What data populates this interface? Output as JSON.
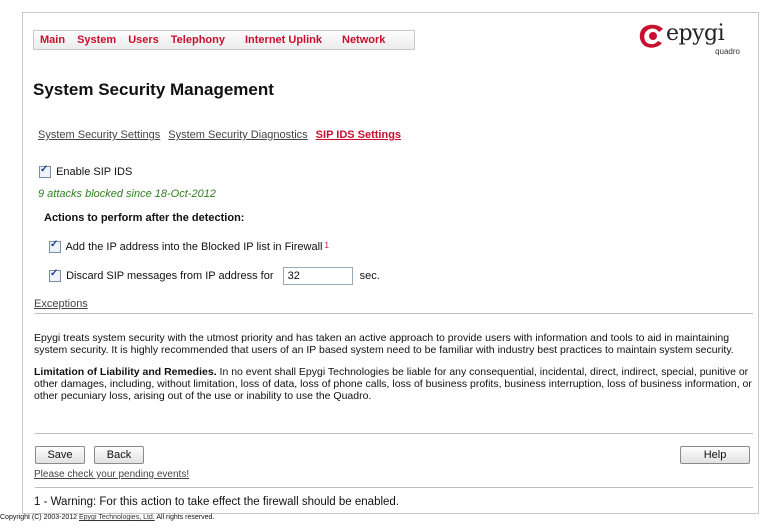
{
  "menu": [
    "Main",
    "System",
    "Users",
    "Telephony",
    "Internet Uplink",
    "Network"
  ],
  "logo": {
    "word": "epygi",
    "sub": "quadro",
    "color": "#c8102e"
  },
  "page_title": "System Security Management",
  "tabs": [
    "System Security Settings",
    "System Security Diagnostics",
    "SIP IDS Settings"
  ],
  "active_tab": "SIP IDS Settings",
  "enable_sip_ids": {
    "label": "Enable SIP IDS",
    "checked": true
  },
  "attacks_status": "9 attacks blocked since 18-Oct-2012",
  "actions_heading": "Actions to perform after the detection:",
  "action_blocklist": {
    "label": "Add the IP address into the Blocked IP list in Firewall",
    "note": "1",
    "checked": true
  },
  "action_discard": {
    "label": "Discard SIP messages from IP address for",
    "value": "32",
    "unit": "sec.",
    "checked": true
  },
  "exceptions_link": "Exceptions",
  "intro_text": "Epygi treats system security with the utmost priority and has taken an active approach to provide users with information and tools to aid in maintaining system security. It is highly recommended that users of an IP based system need to be familiar with industry best practices to maintain system security.",
  "liability_title": "Limitation of Liability and Remedies.",
  "liability_text": "In no event shall Epygi Technologies be liable for any consequential, incidental, direct, indirect, special, punitive or other damages, including, without limitation, loss of data, loss of phone calls, loss of business profits, business interruption, loss of business information, or other pecuniary loss, arising out of the use or inability to use the Quadro.",
  "buttons": {
    "save": "Save",
    "back": "Back",
    "help": "Help"
  },
  "pending_events_link": "Please check your pending events!",
  "footnote": "1 - Warning: For this action to take effect the firewall should be enabled.",
  "copyright": {
    "prefix": "Copyright (C) 2003-2012",
    "company": "Epygi Technologies, Ltd.",
    "suffix": "All rights reserved."
  }
}
